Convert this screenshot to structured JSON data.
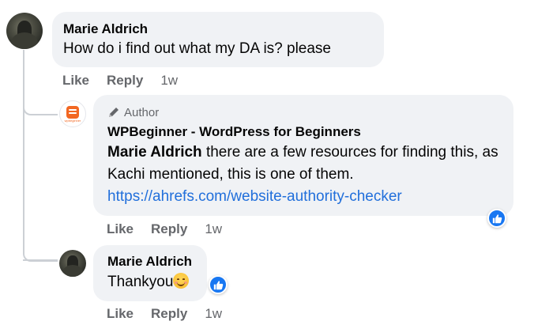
{
  "comment1": {
    "author": "Marie Aldrich",
    "text": "How do i find out what my DA is? please",
    "actions": {
      "like": "Like",
      "reply": "Reply",
      "time": "1w"
    }
  },
  "reply1": {
    "badge": "Author",
    "author": "WPBeginner - WordPress for Beginners",
    "mention": "Marie Aldrich",
    "text": " there are a few resources for finding this, as Kachi mentioned, this is one of them.",
    "link": "https://ahrefs.com/website-authority-checker",
    "avatar_caption": "wpbeginner",
    "actions": {
      "like": "Like",
      "reply": "Reply",
      "time": "1w"
    }
  },
  "reply2": {
    "author": "Marie Aldrich",
    "text": "Thankyou",
    "actions": {
      "like": "Like",
      "reply": "Reply",
      "time": "1w"
    }
  },
  "icons": {
    "pencil": "pencil-icon",
    "reaction": "like-reaction-icon",
    "emoji": "smiling-face-emoji"
  },
  "colors": {
    "bubble": "#f0f2f5",
    "link": "#216fdb",
    "like_blue": "#1877f2",
    "wpbeginner_orange": "#f26722"
  }
}
